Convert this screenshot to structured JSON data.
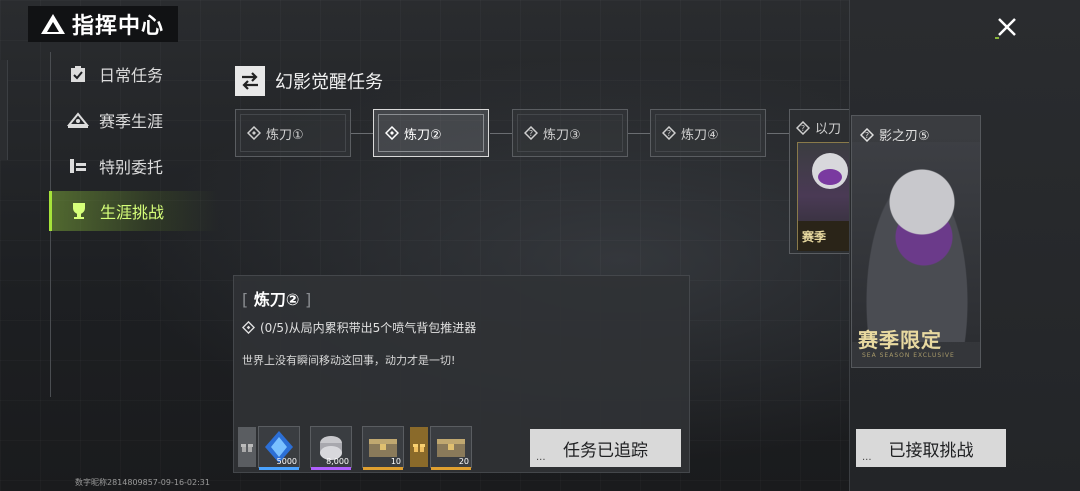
{
  "header": {
    "title": "指挥中心"
  },
  "sidebar": {
    "items": [
      {
        "label": "日常任务",
        "icon": "clipboard-icon",
        "active": false
      },
      {
        "label": "赛季生涯",
        "icon": "season-icon",
        "active": false
      },
      {
        "label": "特别委托",
        "icon": "commission-icon",
        "active": false
      },
      {
        "label": "生涯挑战",
        "icon": "trophy-icon",
        "active": true
      }
    ]
  },
  "section": {
    "title": "幻影觉醒任务"
  },
  "stages": [
    {
      "label": "炼刀①",
      "active": false
    },
    {
      "label": "炼刀②",
      "active": true
    },
    {
      "label": "炼刀③",
      "active": false
    },
    {
      "label": "炼刀④",
      "active": false
    },
    {
      "label": "以刀",
      "active": false
    }
  ],
  "reward_card": {
    "label": "影之刃⑤",
    "badge": "赛季限定",
    "badge_small": "赛季",
    "badge_sub": "SEA SEASON EXCLUSIVE"
  },
  "detail": {
    "bracket_open": "[",
    "bracket_close": "]",
    "name": "炼刀②",
    "objective": "(0/5)从局内累积带出5个喷气背包推进器",
    "description": "世界上没有瞬间移动这回事，动力才是一切!"
  },
  "rewards": [
    {
      "count": "5000",
      "color": "#4aa3ff"
    },
    {
      "count": "8,000",
      "color": "#b060ff"
    },
    {
      "count": "10",
      "color": "#e0a030"
    },
    {
      "count": "20",
      "color": "#e0a030"
    }
  ],
  "buttons": {
    "tracked": "任务已追踪",
    "accepted": "已接取挑战",
    "dots": "..."
  },
  "footer": {
    "id_text": "数字昵称2814809857-09-16-02:31"
  },
  "colors": {
    "accent": "#a6e33a",
    "button_bg": "#d9d9d9"
  }
}
